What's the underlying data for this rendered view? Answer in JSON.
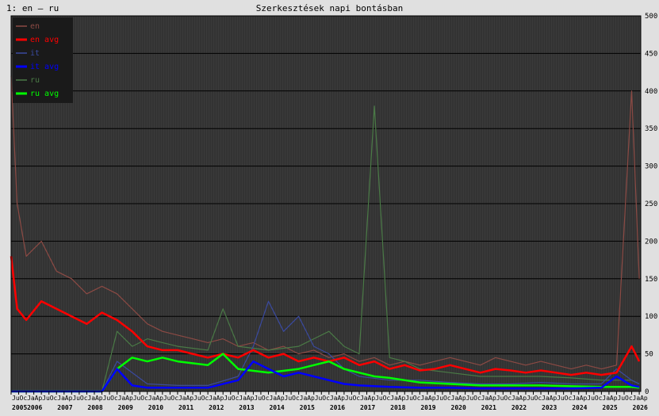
{
  "header": {
    "label": "1: en – ru",
    "title": "Szerkesztések napi bontásban"
  },
  "colors": {
    "background": "#e0e0e0",
    "plot_background": "#3a3a3a",
    "grid_line": "#000000",
    "en": "#8c4a44",
    "en_avg": "#ff0000",
    "it": "#3a4aa0",
    "it_avg": "#0000ff",
    "ru": "#4a7a46",
    "ru_avg": "#00ff00"
  },
  "chart_data": {
    "type": "line",
    "title": "Szerkesztések napi bontásban",
    "xlabel": "",
    "ylabel": "",
    "ylim": [
      0,
      500
    ],
    "y_ticks": [
      0,
      50,
      100,
      150,
      200,
      250,
      300,
      350,
      400,
      450,
      500
    ],
    "y_axis_side": "right",
    "grid": true,
    "legend_placement": "top-left",
    "x_year_labels": [
      "2005",
      "2006",
      "2007",
      "2008",
      "2009",
      "2010",
      "2011",
      "2012",
      "2013",
      "2014",
      "2015",
      "2016",
      "2017",
      "2018",
      "2019",
      "2020",
      "2021",
      "2022",
      "2023",
      "2024",
      "2025",
      "2026"
    ],
    "x_month_label_cycle": [
      "Ja",
      "Ap",
      "Ju",
      "Oc"
    ],
    "series": [
      {
        "name": "en",
        "x": [
          2005.5,
          2005.7,
          2006.0,
          2006.5,
          2007.0,
          2007.5,
          2008.0,
          2008.5,
          2009.0,
          2009.5,
          2010.0,
          2010.5,
          2011.0,
          2011.5,
          2012.0,
          2012.5,
          2013.0,
          2013.5,
          2014.0,
          2014.5,
          2015.0,
          2015.5,
          2016.0,
          2016.5,
          2017.0,
          2017.5,
          2018.0,
          2018.5,
          2019.0,
          2019.5,
          2020.0,
          2020.5,
          2021.0,
          2021.5,
          2022.0,
          2022.5,
          2023.0,
          2023.5,
          2024.0,
          2024.5,
          2025.0,
          2025.5,
          2026.0,
          2026.25
        ],
        "values": [
          420,
          250,
          180,
          200,
          160,
          150,
          130,
          140,
          130,
          110,
          90,
          80,
          75,
          70,
          65,
          70,
          60,
          65,
          55,
          60,
          50,
          55,
          45,
          50,
          40,
          45,
          35,
          40,
          35,
          40,
          45,
          40,
          35,
          45,
          40,
          35,
          40,
          35,
          30,
          35,
          30,
          35,
          400,
          150
        ]
      },
      {
        "name": "en avg",
        "x": [
          2005.5,
          2005.7,
          2006.0,
          2006.5,
          2007.0,
          2007.5,
          2008.0,
          2008.5,
          2009.0,
          2009.5,
          2010.0,
          2010.5,
          2011.0,
          2011.5,
          2012.0,
          2012.5,
          2013.0,
          2013.5,
          2014.0,
          2014.5,
          2015.0,
          2015.5,
          2016.0,
          2016.5,
          2017.0,
          2017.5,
          2018.0,
          2018.5,
          2019.0,
          2019.5,
          2020.0,
          2020.5,
          2021.0,
          2021.5,
          2022.0,
          2022.5,
          2023.0,
          2023.5,
          2024.0,
          2024.5,
          2025.0,
          2025.5,
          2026.0,
          2026.25
        ],
        "values": [
          180,
          110,
          95,
          120,
          110,
          100,
          90,
          105,
          95,
          80,
          60,
          55,
          55,
          50,
          45,
          50,
          45,
          55,
          45,
          50,
          40,
          45,
          40,
          45,
          35,
          40,
          30,
          35,
          28,
          30,
          35,
          30,
          25,
          30,
          28,
          25,
          28,
          25,
          22,
          25,
          22,
          25,
          60,
          40
        ]
      },
      {
        "name": "it",
        "x": [
          2005.5,
          2008.5,
          2009.0,
          2010.0,
          2011.0,
          2012.0,
          2013.0,
          2013.5,
          2014.0,
          2014.5,
          2015.0,
          2015.5,
          2016.0,
          2016.5,
          2017.0,
          2018.0,
          2019.0,
          2020.0,
          2021.0,
          2022.0,
          2023.0,
          2024.0,
          2025.0,
          2025.5,
          2026.0,
          2026.25
        ],
        "values": [
          0,
          0,
          40,
          10,
          8,
          8,
          20,
          60,
          120,
          80,
          100,
          60,
          50,
          30,
          20,
          15,
          15,
          12,
          10,
          10,
          12,
          10,
          10,
          30,
          15,
          10
        ]
      },
      {
        "name": "it avg",
        "x": [
          2005.5,
          2008.5,
          2009.0,
          2009.5,
          2010.0,
          2011.0,
          2012.0,
          2013.0,
          2013.5,
          2014.0,
          2014.5,
          2015.0,
          2015.5,
          2016.0,
          2016.5,
          2017.0,
          2018.0,
          2019.0,
          2020.0,
          2021.0,
          2022.0,
          2023.0,
          2024.0,
          2025.0,
          2025.5,
          2026.0,
          2026.25
        ],
        "values": [
          0,
          0,
          30,
          8,
          5,
          5,
          5,
          15,
          40,
          30,
          20,
          25,
          20,
          15,
          10,
          8,
          6,
          5,
          5,
          4,
          4,
          4,
          4,
          5,
          20,
          8,
          6
        ]
      },
      {
        "name": "ru",
        "x": [
          2005.5,
          2008.5,
          2009.0,
          2009.5,
          2010.0,
          2010.5,
          2011.0,
          2012.0,
          2012.5,
          2013.0,
          2014.0,
          2015.0,
          2015.5,
          2016.0,
          2016.5,
          2017.0,
          2017.5,
          2018.0,
          2018.5,
          2019.0,
          2020.0,
          2021.0,
          2022.0,
          2023.0,
          2024.0,
          2025.0,
          2026.0,
          2026.25
        ],
        "values": [
          0,
          0,
          80,
          60,
          70,
          65,
          60,
          55,
          110,
          60,
          55,
          60,
          70,
          80,
          60,
          50,
          380,
          45,
          40,
          30,
          25,
          20,
          20,
          20,
          18,
          15,
          15,
          10
        ]
      },
      {
        "name": "ru avg",
        "x": [
          2005.5,
          2008.5,
          2009.0,
          2009.5,
          2010.0,
          2010.5,
          2011.0,
          2012.0,
          2012.5,
          2013.0,
          2014.0,
          2015.0,
          2015.5,
          2016.0,
          2016.5,
          2017.0,
          2017.5,
          2018.0,
          2018.5,
          2019.0,
          2020.0,
          2021.0,
          2022.0,
          2023.0,
          2024.0,
          2025.0,
          2026.0,
          2026.25
        ],
        "values": [
          0,
          0,
          30,
          45,
          40,
          45,
          40,
          35,
          50,
          30,
          25,
          30,
          35,
          40,
          30,
          25,
          20,
          18,
          15,
          12,
          10,
          8,
          8,
          8,
          7,
          6,
          6,
          5
        ]
      }
    ]
  }
}
